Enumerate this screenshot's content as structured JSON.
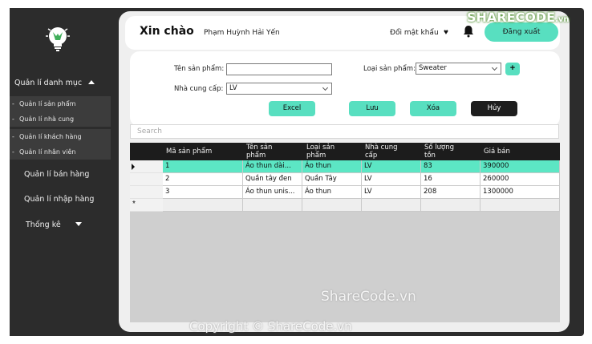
{
  "sidebar": {
    "logo_icon": "lightbulb-icon",
    "menu_title": "Quản lí danh mục",
    "sub_items": [
      "Quản lí sản phẩm",
      "Quản lí nhà cung",
      "Quản lí khách hàng",
      "Quản lí nhân viên"
    ],
    "nav_items": [
      "Quản lí bán hàng",
      "Quản lí nhập hàng",
      "Thống kê"
    ]
  },
  "header": {
    "greeting": "Xin chào",
    "username": "Phạm Huỳnh Hải Yến",
    "change_password": "Đổi mật khẩu",
    "logout": "Đăng xuất",
    "accent_color": "#58dfc0"
  },
  "form": {
    "product_name_label": "Tên sản phẩm:",
    "product_name_value": "",
    "category_label": "Loại sản phẩm:",
    "category_value": "Sweater",
    "add_button": "+",
    "supplier_label": "Nhà cung cấp:",
    "supplier_value": "LV",
    "buttons": {
      "excel": "Excel",
      "save": "Lưu",
      "delete": "Xóa",
      "cancel": "Hủy"
    }
  },
  "search": {
    "placeholder": "Search"
  },
  "table": {
    "headers": [
      [
        "Mã sản phẩm",
        ""
      ],
      [
        "Tên sản",
        "phẩm"
      ],
      [
        "Loại sản",
        "phẩm"
      ],
      [
        "Nhà cung",
        "cấp"
      ],
      [
        "Số lượng",
        "tồn"
      ],
      [
        "Giá bán",
        ""
      ]
    ],
    "rows": [
      [
        "1",
        "Áo  thun dài...",
        "Áo thun",
        "LV",
        "83",
        "390000"
      ],
      [
        "2",
        "Quần tây đen",
        "Quần Tây",
        "LV",
        "16",
        "260000"
      ],
      [
        "3",
        "Áo thun unis...",
        "Áo thun",
        "LV",
        "208",
        "1300000"
      ]
    ],
    "selected_row_color": "#5ce6c4",
    "new_row_marker": "*"
  },
  "watermarks": {
    "logo": "SHARECODE",
    "logo_suffix": ".vn",
    "center": "ShareCode.vn",
    "bottom": "Copyright © ShareCode.vn"
  }
}
